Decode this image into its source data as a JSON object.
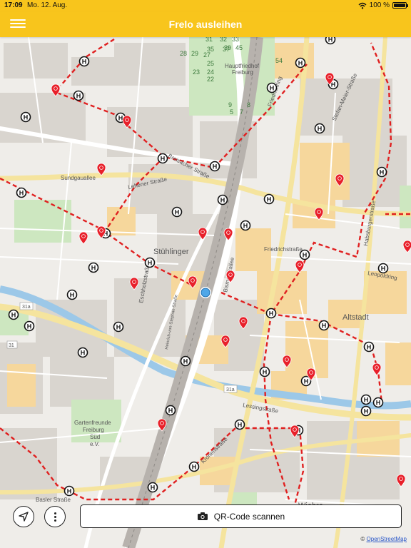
{
  "status_bar": {
    "time": "17:09",
    "date": "Mo. 12. Aug.",
    "battery": "100 %",
    "battery_level": 1.0
  },
  "nav": {
    "title": "Frelo ausleihen"
  },
  "map": {
    "colors": {
      "bike_station": "#e8202a",
      "route": "#e02020",
      "bus_stop_ring": "#111111",
      "user_location": "#4fa7e8"
    },
    "labels": {
      "neighbourhoods": [
        "Stühlinger",
        "Altstadt",
        "Wiehre"
      ],
      "cemetery": [
        "Hauptfriedhof",
        "Freiburg"
      ],
      "garden": [
        "Gartenfreunde",
        "Freiburg",
        "Süd",
        "e.V."
      ],
      "streets": [
        "Breisacher Straße",
        "Sundgauallee",
        "Lehener Straße",
        "Eschholzstraße",
        "Friedrichstraße",
        "Bismarckallee",
        "Habsburgerstraße",
        "Leopoldring",
        "Lessingstraße",
        "Kronenstraße",
        "Basler Straße",
        "Friedrichring",
        "Stefan-Meier-Straße",
        "Heinrich-von-Stephan-Straße"
      ],
      "road_badges": [
        "31a",
        "31",
        "31a"
      ],
      "cemetery_numbers": [
        "31",
        "32",
        "33",
        "35",
        "37",
        "28",
        "29",
        "27",
        "39",
        "45",
        "23",
        "24",
        "25",
        "22",
        "54",
        "9",
        "5",
        "7",
        "8"
      ]
    }
  },
  "controls": {
    "qr_label": "QR-Code scannen"
  },
  "attribution": {
    "prefix": "©",
    "link": "OpenStreetMap"
  }
}
